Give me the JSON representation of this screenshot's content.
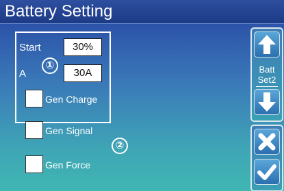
{
  "header": {
    "title": "Battery Setting"
  },
  "settings": {
    "start_label": "Start",
    "a_label": "A",
    "start_value": "30%",
    "a_value": "30A",
    "marker_1": "①",
    "marker_2": "②",
    "gen_charge_label": "Gen Charge",
    "gen_signal_label": "Gen Signal",
    "gen_force_label": "Gen Force"
  },
  "sidebar": {
    "page_label_line1": "Batt",
    "page_label_line2": "Set2"
  },
  "colors": {
    "title_bar": "#1f3d87",
    "background_bottom": "#3fb6b2",
    "button_blue": "#2b6fb0"
  },
  "icons": [
    "arrow-up-icon",
    "arrow-down-icon",
    "cancel-x-icon",
    "confirm-check-icon"
  ]
}
